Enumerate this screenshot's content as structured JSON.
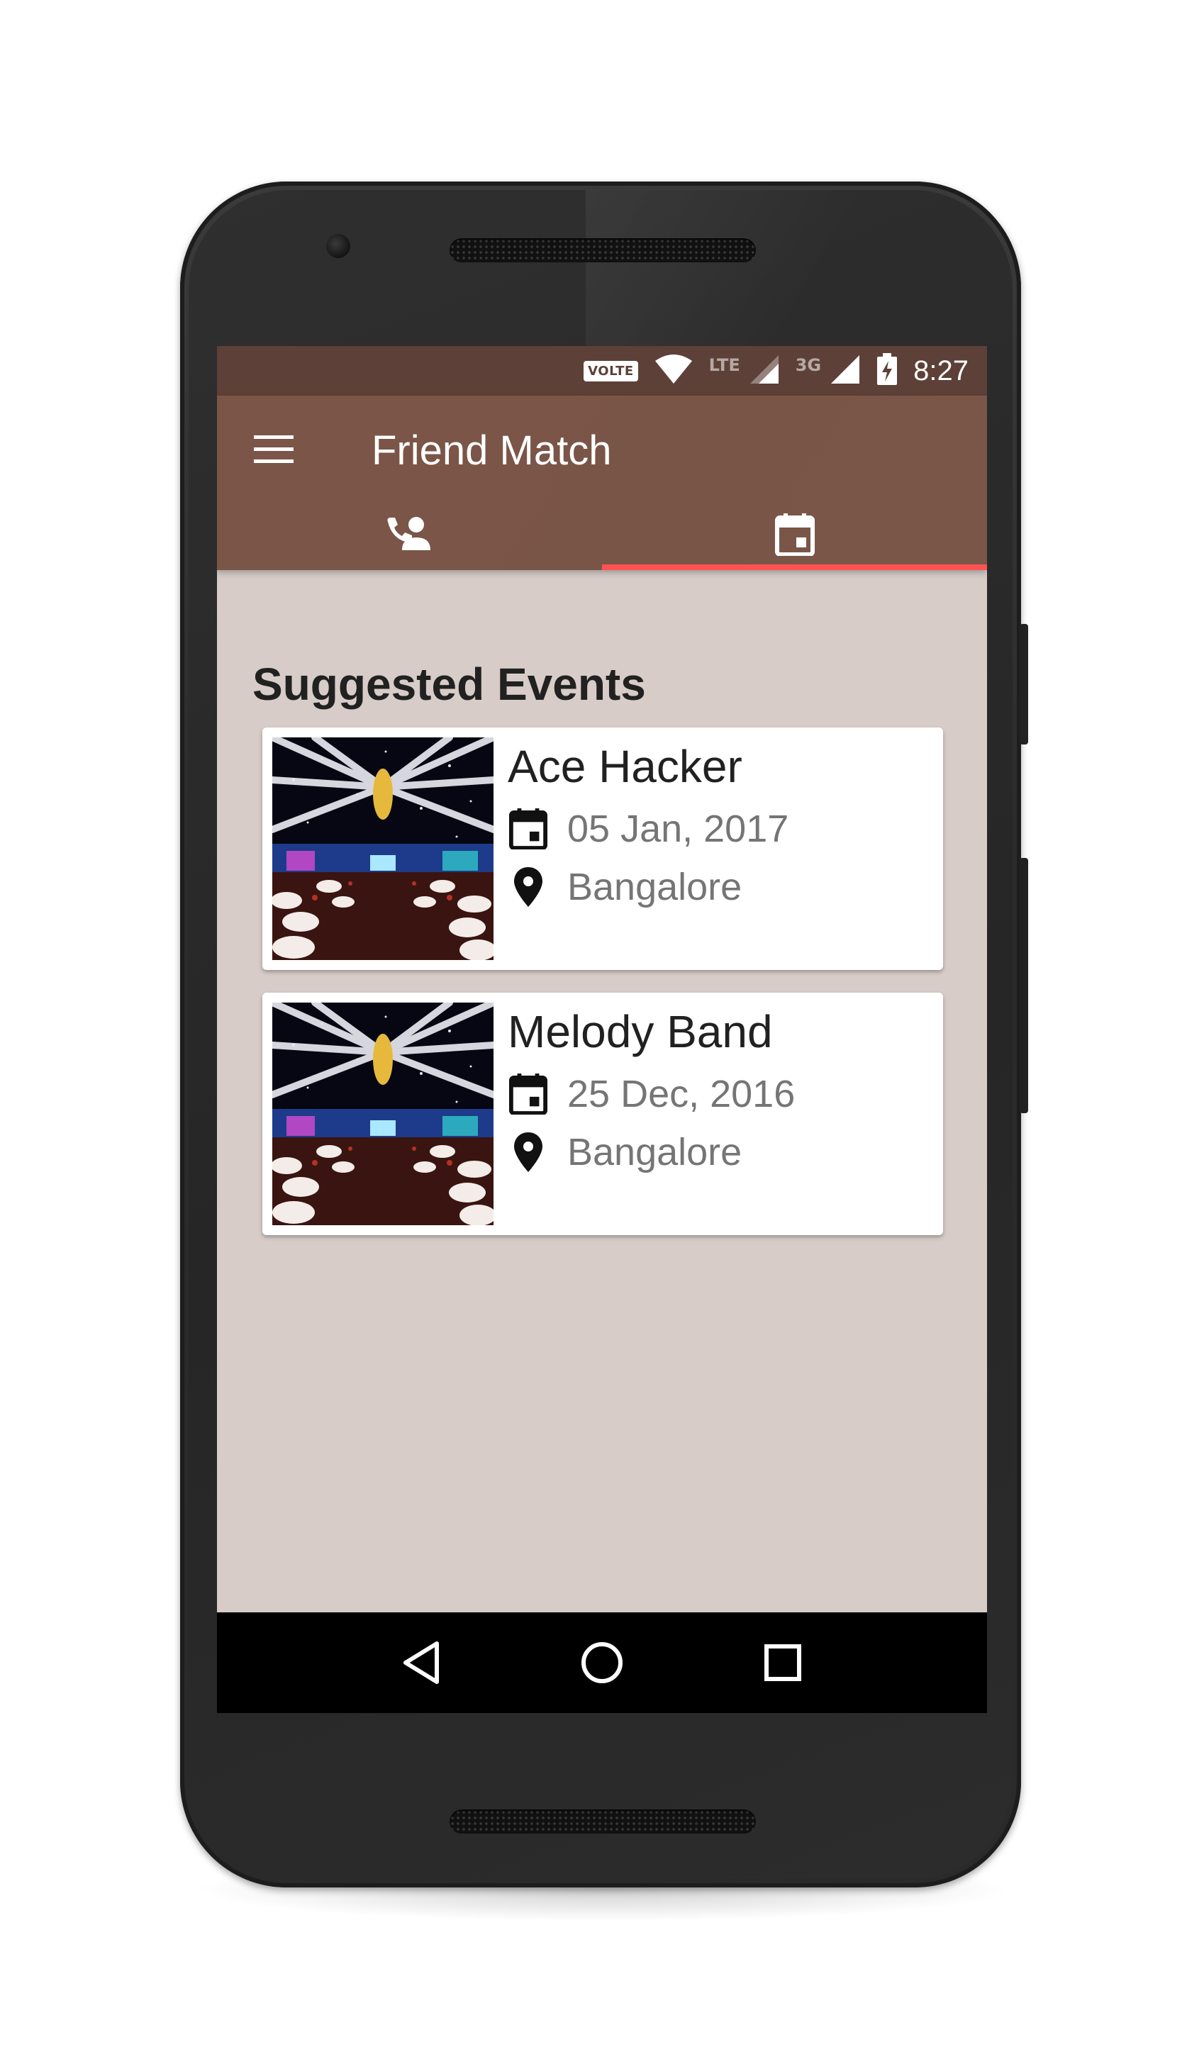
{
  "status_bar": {
    "volte_label": "VOLTE",
    "lte_label": "LTE",
    "network_3g_label": "3G",
    "time": "8:27"
  },
  "app_bar": {
    "title": "Friend Match",
    "menu_icon": "hamburger-menu-icon",
    "tabs": [
      {
        "icon": "contact-phone-icon",
        "selected": false
      },
      {
        "icon": "calendar-event-icon",
        "selected": true
      }
    ],
    "tab_indicator_color": "#ff5252"
  },
  "main": {
    "section_title": "Suggested Events",
    "events": [
      {
        "name": "Ace Hacker",
        "date": "05 Jan, 2017",
        "location": "Bangalore",
        "thumbnail": "event-hall-photo"
      },
      {
        "name": "Melody Band",
        "date": "25 Dec, 2016",
        "location": "Bangalore",
        "thumbnail": "event-hall-photo"
      }
    ]
  },
  "nav_bar": {
    "back_icon": "back-triangle-icon",
    "home_icon": "home-circle-icon",
    "recents_icon": "recents-square-icon"
  },
  "colors": {
    "status_bar": "#5d4037",
    "app_bar": "#795548",
    "background": "#d7ccc8",
    "accent": "#ff5252"
  }
}
